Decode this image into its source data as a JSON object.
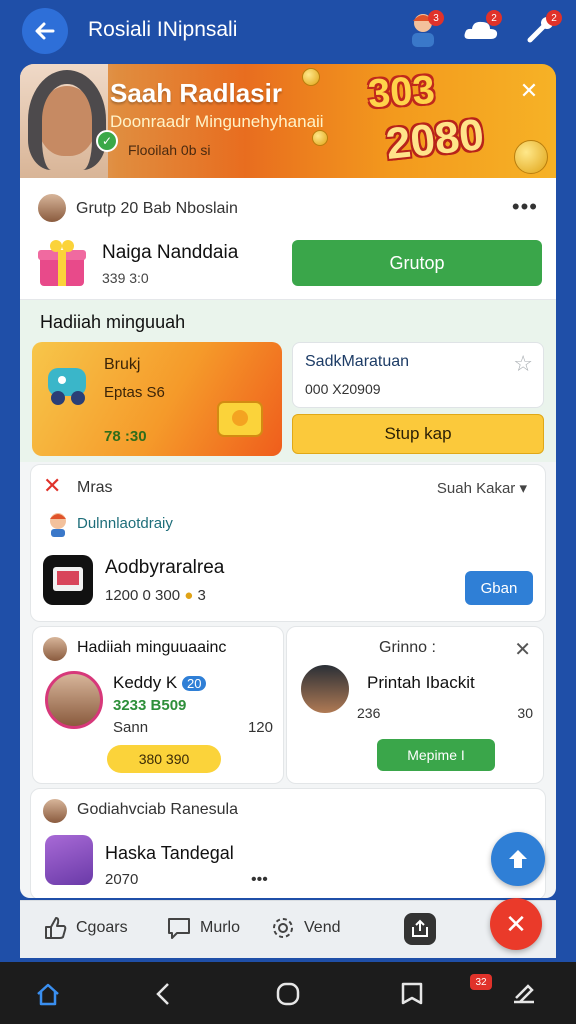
{
  "topbar": {
    "title": "Rosiali INipnsali",
    "badges": [
      "3",
      "2",
      "2"
    ]
  },
  "hero": {
    "title": "Saah Radlasir",
    "subtitle": "Doonraadr Mingunehyhanaii",
    "meta": "Flooilah 0b si",
    "number_top": "303",
    "number_bottom": "2080",
    "accent": "#e86d1f"
  },
  "group_card": {
    "header": "Grutp 20 Bab Nboslain",
    "name": "Naiga Nanddaia",
    "meta": "339 3:0",
    "button": "Grutop",
    "button_color": "#3aa64a"
  },
  "weekly": {
    "title": "Hadiiah minguuah",
    "orange_card": {
      "title": "Brukj",
      "subtitle": "Eptas S6",
      "footer": "78 :30"
    },
    "white_card": {
      "title": "SadkMaratuan",
      "meta": "000  X20909"
    },
    "button": "Stup kap"
  },
  "trend": {
    "header": "Mras",
    "sort": "Suah Kakar",
    "subheader": "Dulnnlaotdraiy",
    "app_name": "Aodbyraralrea",
    "meta": "1200 0 300",
    "meta_suffix": "3",
    "button": "Gban"
  },
  "left_card": {
    "header": "Hadiiah minguuaainc",
    "name": "Keddy K",
    "name_badge": "20",
    "green": "3233 B509",
    "sub": "Sann",
    "num": "120",
    "pill": "380  390"
  },
  "right_card": {
    "header": "Grinno :",
    "name": "Printah Ibackit",
    "meta": "236",
    "num": "30",
    "button": "Mepime I"
  },
  "bottom_card": {
    "header": "Godiahvciab Ranesula",
    "name": "Haska Tandegal",
    "meta": "2070"
  },
  "actionbar": {
    "item1": "Cgoars",
    "item2": "Murlo",
    "item3": "Vend"
  },
  "sysnav": {
    "badge": "32"
  }
}
